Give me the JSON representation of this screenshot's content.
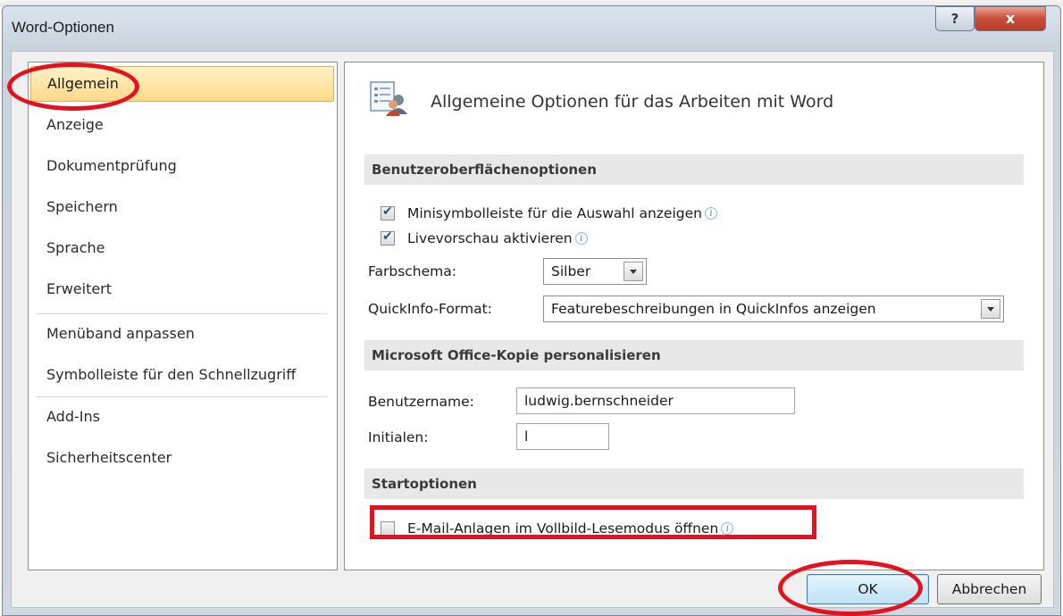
{
  "window": {
    "title": "Word-Optionen",
    "help_button": "?",
    "close_button": "x"
  },
  "sidebar": {
    "items": [
      {
        "label": "Allgemein",
        "selected": true
      },
      {
        "label": "Anzeige"
      },
      {
        "label": "Dokumentprüfung"
      },
      {
        "label": "Speichern"
      },
      {
        "label": "Sprache"
      },
      {
        "label": "Erweitert"
      },
      {
        "label": "Menüband anpassen"
      },
      {
        "label": "Symbolleiste für den Schnellzugriff"
      },
      {
        "label": "Add-Ins"
      },
      {
        "label": "Sicherheitscenter"
      }
    ]
  },
  "main": {
    "header_icon": "general-options-icon",
    "title": "Allgemeine Optionen für das Arbeiten mit Word",
    "ui_options": {
      "heading": "Benutzeroberflächenoptionen",
      "minitoolbar_label": "Minisymbolleiste für die Auswahl anzeigen",
      "minitoolbar_checked": true,
      "livepreview_label": "Livevorschau aktivieren",
      "livepreview_checked": true,
      "colorscheme_label": "Farbschema:",
      "colorscheme_value": "Silber",
      "screentip_label": "QuickInfo-Format:",
      "screentip_value": "Featurebeschreibungen in QuickInfos anzeigen"
    },
    "personalize": {
      "heading": "Microsoft Office-Kopie personalisieren",
      "username_label": "Benutzername:",
      "username_value": "ludwig.bernschneider",
      "initials_label": "Initialen:",
      "initials_value": "l"
    },
    "startup": {
      "heading": "Startoptionen",
      "email_attachments_label": "E-Mail-Anlagen im Vollbild-Lesemodus öffnen",
      "email_attachments_checked": false
    }
  },
  "buttons": {
    "ok": "OK",
    "cancel": "Abbrechen"
  },
  "colors": {
    "annotation_red": "#e3121e",
    "selected_nav": "#ffd88a",
    "section_bar": "#e8e8e8"
  }
}
